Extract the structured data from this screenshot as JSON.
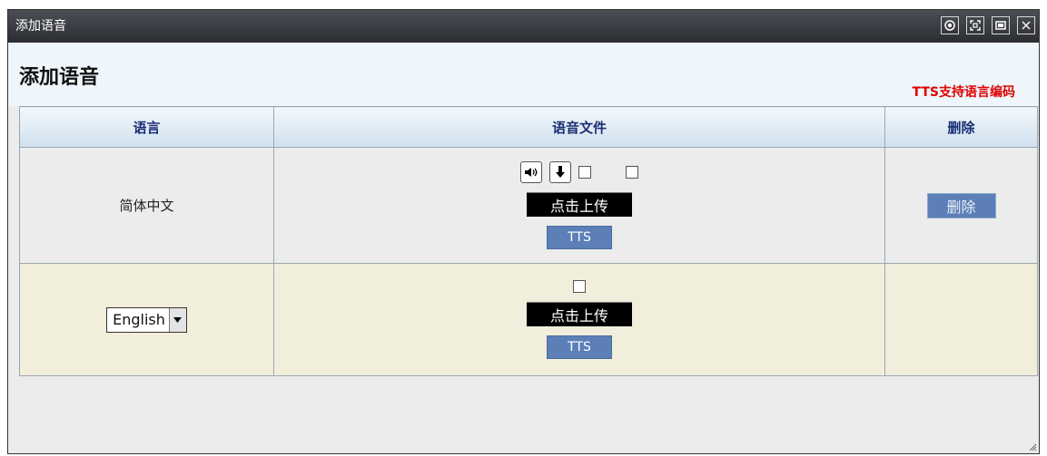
{
  "window": {
    "title": "添加语音"
  },
  "header": {
    "title": "添加语音",
    "tts_link": "TTS支持语言编码"
  },
  "table": {
    "headers": [
      "语言",
      "语音文件",
      "删除"
    ],
    "rows": [
      {
        "language": "简体中文",
        "upload_label": "点击上传",
        "tts_label": "TTS",
        "delete_label": "删除"
      },
      {
        "language_select_value": "English",
        "upload_label": "点击上传",
        "tts_label": "TTS"
      }
    ]
  },
  "icons": {
    "titlebar": [
      "record-icon",
      "fullscreen-icon",
      "restore-icon",
      "close-icon"
    ],
    "row1": [
      "speaker-icon",
      "download-arrow-icon"
    ]
  },
  "colors": {
    "titlebar_bg": "#3a3c42",
    "header_bg": "#eef6fb",
    "table_header_text": "#1a2e74",
    "tts_link": "#e00000",
    "row2_bg": "#f2eedc",
    "button_blue": "#5b7fb6"
  }
}
